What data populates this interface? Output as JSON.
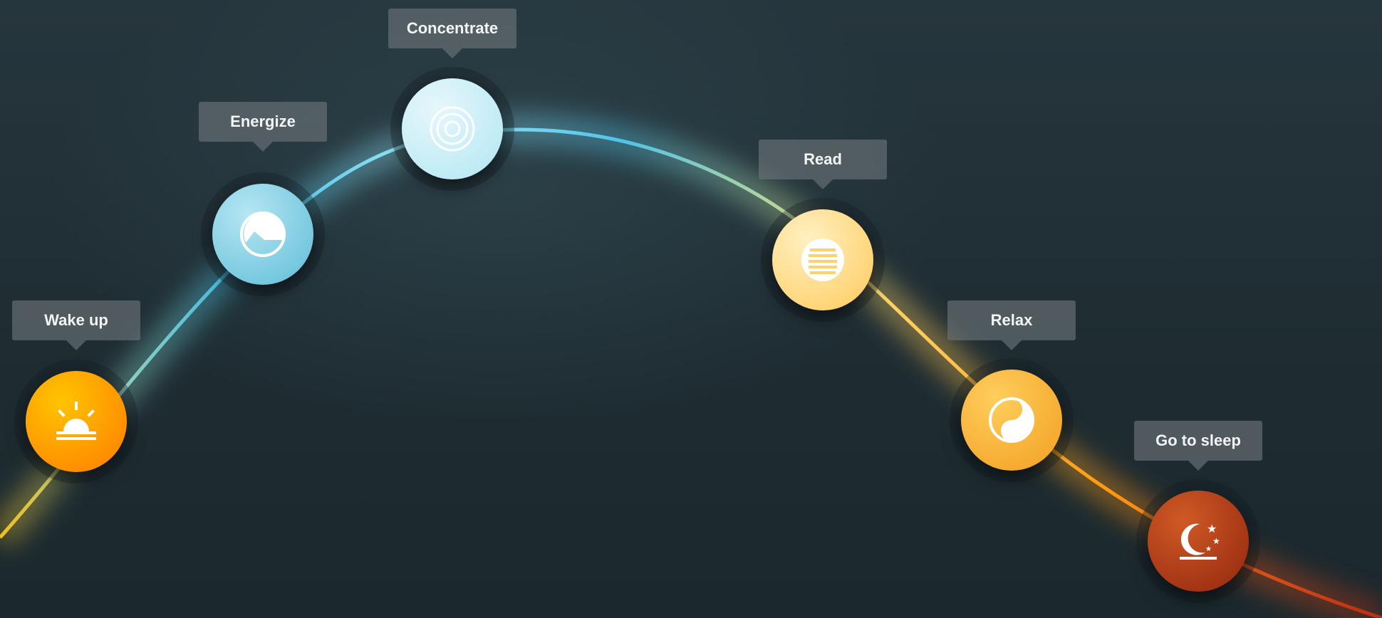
{
  "scenes": [
    {
      "id": "wake-up",
      "label": "Wake up",
      "icon": "sunrise-icon",
      "colors": [
        "#ffc400",
        "#ff8a00"
      ],
      "icon_color": "#ffffff"
    },
    {
      "id": "energize",
      "label": "Energize",
      "icon": "energize-icon",
      "colors": [
        "#b6e6f3",
        "#6cc3dc"
      ],
      "icon_color": "#ffffff"
    },
    {
      "id": "concentrate",
      "label": "Concentrate",
      "icon": "concentric-circles-icon",
      "colors": [
        "#e6f7fb",
        "#b9e9f4"
      ],
      "icon_color": "#ffffff"
    },
    {
      "id": "read",
      "label": "Read",
      "icon": "read-lines-icon",
      "colors": [
        "#ffe7a8",
        "#ffd06b"
      ],
      "icon_color": "#ffffff"
    },
    {
      "id": "relax",
      "label": "Relax",
      "icon": "yin-yang-icon",
      "colors": [
        "#ffce5c",
        "#f4a52a"
      ],
      "icon_color": "#ffffff"
    },
    {
      "id": "go-to-sleep",
      "label": "Go to sleep",
      "icon": "moon-stars-icon",
      "colors": [
        "#d05a25",
        "#9b2e12"
      ],
      "icon_color": "#ffffff"
    }
  ],
  "curve_colors": [
    "#f0c020",
    "#8fd0c0",
    "#3cb8e0",
    "#9fe8f6",
    "#4fc3e8",
    "#c8d890",
    "#ffd060",
    "#ff9a10",
    "#e0561a",
    "#b82d12"
  ]
}
